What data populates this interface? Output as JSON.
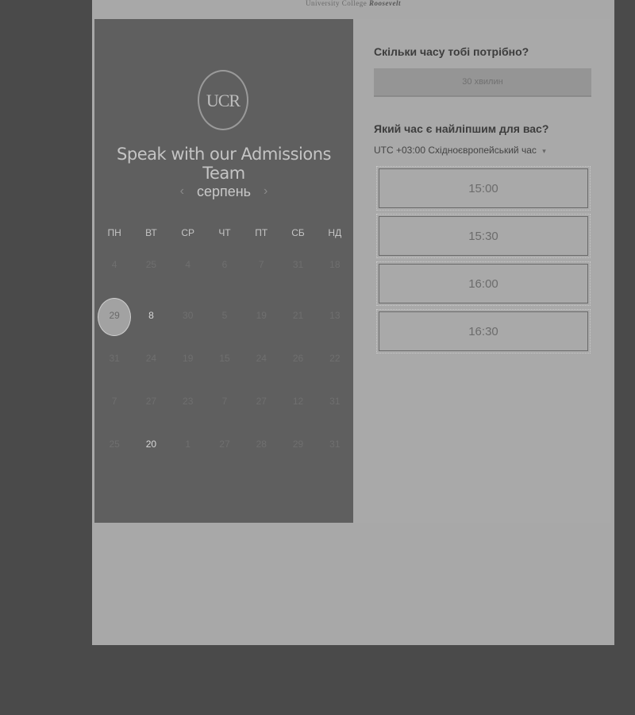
{
  "header": {
    "text": "University College",
    "brand": "Roosevelt"
  },
  "left": {
    "logo": "UCR",
    "title": "Speak with our Admissions Team",
    "month": "серпень",
    "prev_icon": "‹",
    "next_icon": "›",
    "weekdays": [
      "ПН",
      "ВТ",
      "СР",
      "ЧТ",
      "ПТ",
      "СБ",
      "НД"
    ],
    "weeks": [
      [
        "4",
        "25",
        "4",
        "6",
        "7",
        "31",
        "18"
      ],
      [
        "29",
        "8",
        "30",
        "5",
        "19",
        "21",
        "13"
      ],
      [
        "31",
        "24",
        "19",
        "15",
        "24",
        "26",
        "22"
      ],
      [
        "7",
        "27",
        "23",
        "7",
        "27",
        "12",
        "31"
      ],
      [
        "25",
        "20",
        "1",
        "27",
        "28",
        "29",
        "31"
      ]
    ]
  },
  "right": {
    "duration_question": "Скільки часу тобі потрібно?",
    "duration_value": "30 хвилин",
    "time_question": "Який час є найліпшим для вас?",
    "timezone": "UTC +03:00 Східноєвропейський час",
    "timezone_caret": "▾",
    "slots": [
      "15:00",
      "15:30",
      "16:00",
      "16:30"
    ]
  },
  "colors": {
    "backdrop": "#4a4a4a",
    "page": "#a8a8a8",
    "left_panel": "#5f5f5f"
  }
}
